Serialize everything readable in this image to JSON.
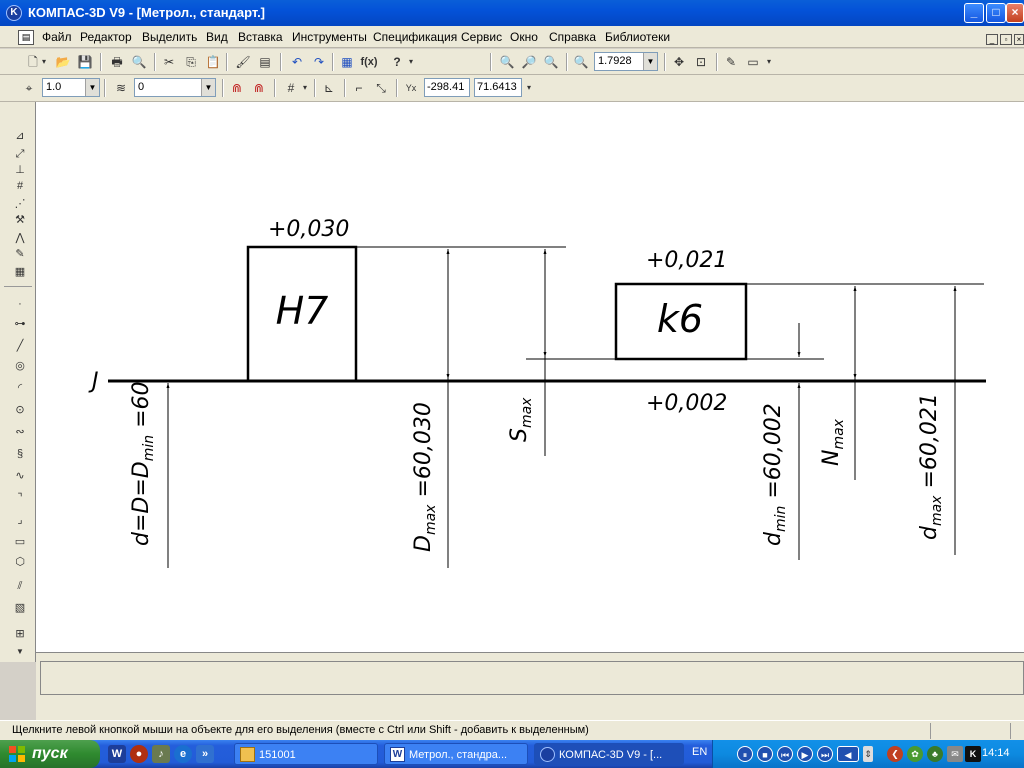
{
  "window": {
    "title": "КОМПАС-3D V9 - [Метрол., стандарт.]",
    "app_icon": "kompas-logo-icon"
  },
  "menu": {
    "items": [
      "Файл",
      "Редактор",
      "Выделить",
      "Вид",
      "Вставка",
      "Инструменты",
      "Спецификация",
      "Сервис",
      "Окно",
      "Справка",
      "Библиотеки"
    ]
  },
  "toolbar1": {
    "zoom_value": "1.7928"
  },
  "toolbar2": {
    "step_value": "1.0",
    "layer_value": "0",
    "coord_x": "-298.41",
    "coord_y": "71.6413"
  },
  "drawing": {
    "hole_box_label": "H7",
    "hole_upper_dev": "+0,030",
    "shaft_box_label": "k6",
    "shaft_upper_dev": "+0,021",
    "shaft_lower_dev": "+0,002",
    "zero_line_mark": "J",
    "dim_nominal": {
      "pre": "d=D=D",
      "sub": "min",
      "post": " =60"
    },
    "dim_D_max": {
      "pre": "D",
      "sub": "max",
      "post": " =60,030"
    },
    "dim_S_max": {
      "pre": "S",
      "sub": "max"
    },
    "dim_d_min": {
      "pre": "d",
      "sub": "min",
      "post": " =60,002"
    },
    "dim_N_max": {
      "pre": "N",
      "sub": "max"
    },
    "dim_d_max": {
      "pre": "d",
      "sub": "max",
      "post": " =60,021"
    }
  },
  "status": {
    "hint": "Щелкните левой кнопкой мыши на объекте для его выделения (вместе с Ctrl или Shift - добавить к выделенным)"
  },
  "taskbar": {
    "start_label": "пуск",
    "tasks": [
      "151001",
      "Метрол., стандра...",
      "КОМПАС-3D V9 - [..."
    ],
    "lang": "EN",
    "clock": "14:14"
  }
}
